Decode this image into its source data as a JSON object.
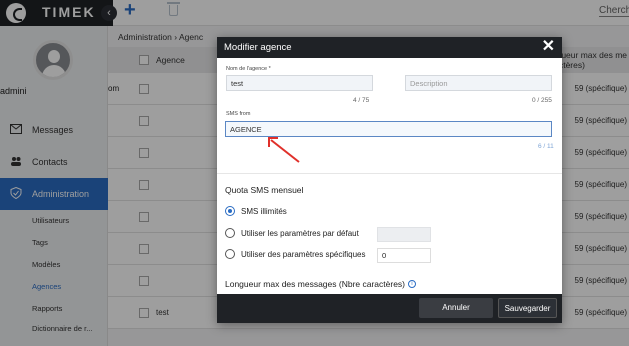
{
  "topbar": {
    "logo_text": "TIMEK",
    "collapse_icon": "‹",
    "add_icon": "+",
    "search_label": "Cherche"
  },
  "sidebar": {
    "username": "admini",
    "items": [
      {
        "label": "Messages"
      },
      {
        "label": "Contacts"
      },
      {
        "label": "Administration"
      }
    ],
    "subitems": [
      {
        "label": "Utilisateurs"
      },
      {
        "label": "Tags"
      },
      {
        "label": "Modèles"
      },
      {
        "label": "Agences"
      },
      {
        "label": "Rapports"
      },
      {
        "label": "Dictionnaire de r..."
      }
    ]
  },
  "breadcrumb": {
    "root": "Administration",
    "sep": "›",
    "current": "Agenc"
  },
  "table": {
    "col_agence": "Agence",
    "col_longueur": "Longueur max des me\ncaractères)",
    "rows": [
      {
        "cell": "om"
      },
      {
        "cell": ""
      },
      {
        "cell": ""
      },
      {
        "cell": ""
      },
      {
        "cell": ""
      },
      {
        "cell": ""
      },
      {
        "cell": ""
      },
      {
        "cell": "test"
      }
    ],
    "right_values": [
      "59 (spécifique)",
      "59 (spécifique)",
      "59 (spécifique)",
      "59 (spécifique)",
      "59 (spécifique)",
      "59 (spécifique)",
      "59 (spécifique)",
      "59 (spécifique)"
    ]
  },
  "modal": {
    "title": "Modifier agence",
    "close_icon": "✕",
    "nom_label": "Nom de l'agence *",
    "nom_value": "test",
    "nom_counter": "4 / 75",
    "description_placeholder": "Description",
    "description_counter": "0 / 255",
    "sms_label": "SMS from",
    "sms_value": "AGENCE",
    "sms_counter": "6 / 11",
    "quota_title": "Quota SMS mensuel",
    "radio_options": [
      {
        "label": "SMS illimités",
        "selected": true
      },
      {
        "label": "Utiliser les paramètres par défaut",
        "selected": false
      },
      {
        "label": "Utiliser des paramètres spécifiques",
        "selected": false
      }
    ],
    "default_value": "",
    "specific_value": "0",
    "longueur_title": "Longueur max des messages (Nbre caractères)",
    "info_icon": "i",
    "cancel_label": "Annuler",
    "save_label": "Sauvegarder"
  },
  "colors": {
    "accent": "#2a6cc3",
    "dark": "#1f2226",
    "arrow": "#e0302a"
  }
}
